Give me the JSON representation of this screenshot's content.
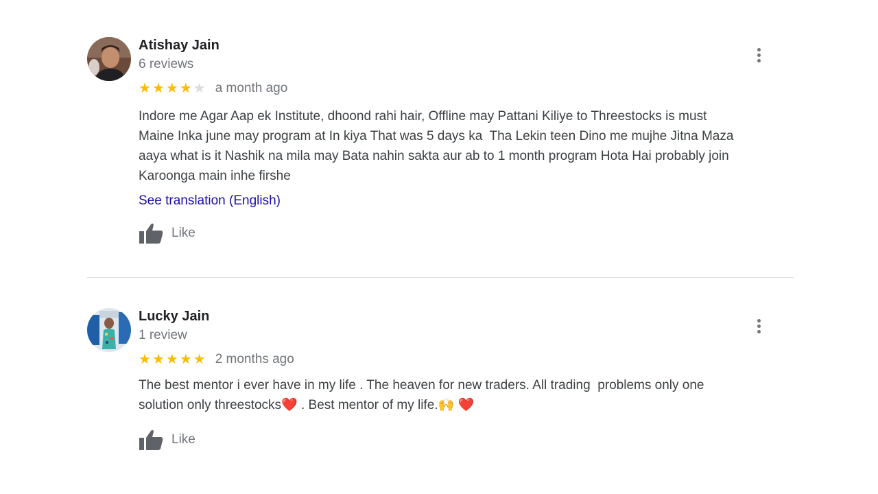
{
  "reviews": [
    {
      "author": "Atishay Jain",
      "review_count": "6 reviews",
      "rating": 4,
      "max_rating": 5,
      "date": "a month ago",
      "text": "Indore me Agar Aap ek Institute, dhoond rahi hair, Offline may Pattani Kiliye to Threestocks is must\nMaine Inka june may program at In kiya That was 5 days ka  Tha Lekin teen Dino me mujhe Jitna Maza\naaya what is it Nashik na mila may Bata nahin sakta aur ab to 1 month program Hota Hai probably join\nKaroonga main inhe firshe",
      "translation_link": "See translation (English)",
      "like_label": "Like"
    },
    {
      "author": "Lucky Jain",
      "review_count": "1 review",
      "rating": 5,
      "max_rating": 5,
      "date": "2 months ago",
      "text": "The best mentor i ever have in my life . The heaven for new traders. All trading  problems only one\nsolution only threestocks❤️ . Best mentor of my life.🙌 ❤️",
      "like_label": "Like"
    }
  ],
  "colors": {
    "star": "#fbbc04",
    "star_empty": "#dadce0",
    "link": "#1a0dab",
    "muted": "#70757a"
  },
  "icons": {
    "more": "more-vert-icon",
    "like": "thumbs-up-icon",
    "star": "star-icon"
  }
}
